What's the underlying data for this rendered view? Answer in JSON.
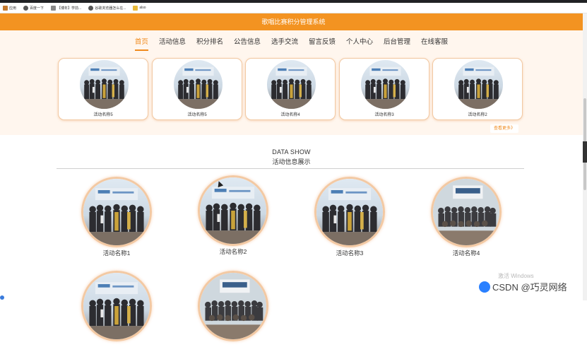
{
  "bookmarks": [
    {
      "label": "应用",
      "icon": "apps-icon"
    },
    {
      "label": "百度一下",
      "icon": "globe-icon"
    },
    {
      "label": "【博年】学前...",
      "icon": "page-icon"
    },
    {
      "label": "谷歌浏览器怎么在...",
      "icon": "globe-icon"
    },
    {
      "label": "also",
      "icon": "folder-icon"
    }
  ],
  "header": {
    "title": "歌唱比赛积分管理系统"
  },
  "nav": {
    "items": [
      "首页",
      "活动信息",
      "积分排名",
      "公告信息",
      "选手交流",
      "留言反馈",
      "个人中心",
      "后台管理",
      "在线客服"
    ],
    "active": 0
  },
  "carousel": {
    "cards": [
      "活动名称5",
      "活动名称5",
      "活动名称4",
      "活动名称3",
      "活动名称2"
    ],
    "more_label": "查看更多》"
  },
  "data_show": {
    "title": "DATA SHOW",
    "subtitle": "活动信息展示",
    "items": [
      "活动名称1",
      "活动名称2",
      "活动名称3",
      "活动名称4",
      "",
      ""
    ]
  },
  "overlay": {
    "activate_text": "激活 Windows",
    "watermark": "CSDN @巧灵网络"
  },
  "colors": {
    "accent": "#f39321",
    "card_border": "#f2c9a3"
  }
}
